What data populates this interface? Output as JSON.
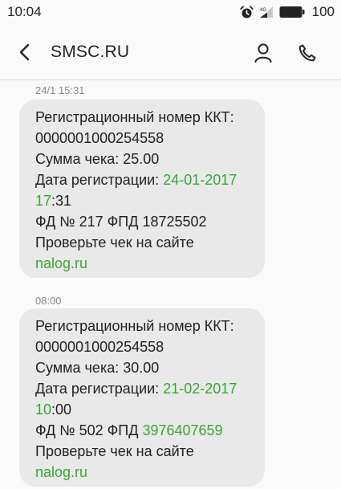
{
  "status_bar": {
    "time": "10:04",
    "battery": "100",
    "icons": [
      "alarm-icon",
      "signal-icon",
      "battery-icon"
    ]
  },
  "header": {
    "title": "SMSC.RU",
    "icons": [
      "back-arrow-icon",
      "contact-icon",
      "phone-icon"
    ]
  },
  "colors": {
    "bubble": "#e9e9e9",
    "link": "#3aa635",
    "timestamp": "#8a8a8a"
  },
  "messages": [
    {
      "timestamp": "24/1 15:31",
      "line1": "Регистрационный номер ККТ:",
      "line2": "0000001000254558",
      "line3": "Сумма чека: 25.00",
      "line4_label": "Дата регистрации: ",
      "line4_date": "24-01-2017",
      "line5_hour": "17",
      "line5_rest": ":31",
      "line6_prefix": "ФД № 217 ФПД ",
      "line6_fpd": "18725502",
      "line7": "Проверьте чек на сайте",
      "link": "nalog.ru"
    },
    {
      "timestamp": "08:00",
      "line1": "Регистрационный номер ККТ:",
      "line2": "0000001000254558",
      "line3": "Сумма чека: 30.00",
      "line4_label": "Дата регистрации: ",
      "line4_date": "21-02-2017",
      "line5_hour": "10",
      "line5_rest": ":00",
      "line6_prefix": "ФД № 502 ФПД ",
      "line6_fpd": "3976407659",
      "line7": "Проверьте чек на сайте",
      "link": "nalog.ru"
    }
  ]
}
